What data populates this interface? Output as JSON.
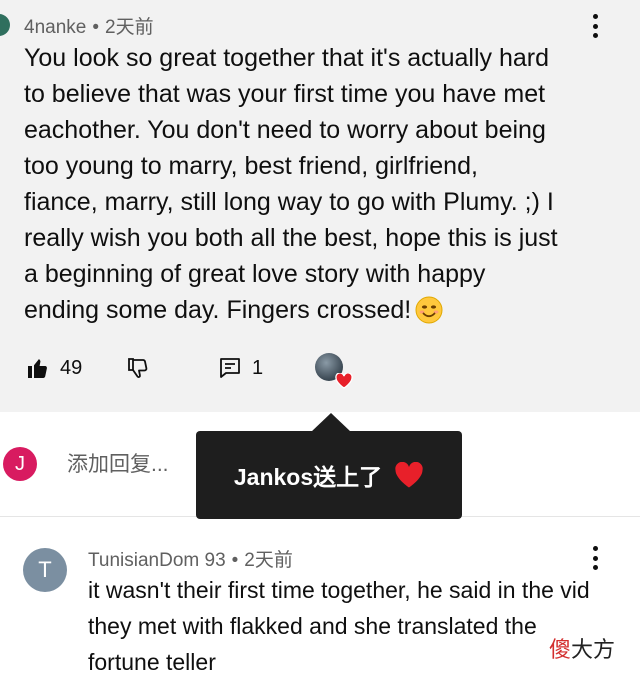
{
  "comment1": {
    "author": "4nanke",
    "separator": "•",
    "time": "2天前",
    "text": "You look so great together that it's actually hard\nto believe that was your first time you have met\neachother. You don't need to worry about being\ntoo young to marry, best friend, girlfriend,\nfiance, marry, still long way to go with Plumy. ;) I\nreally wish you both all the best, hope this is just\na beginning of great love story with happy\nending some day. Fingers crossed!",
    "emoji": "smiling-face-emoji",
    "likes": "49",
    "replies": "1",
    "icons": {
      "like": "thumbs-up-filled-icon",
      "dislike": "thumbs-down-icon",
      "reply": "comment-icon",
      "creator_heart": "heart-icon",
      "menu": "more-vert-icon"
    }
  },
  "reply_box": {
    "avatar_letter": "J",
    "avatar_color": "#d81b60",
    "placeholder": "添加回复..."
  },
  "tooltip": {
    "text": "Jankos送上了"
  },
  "comment2": {
    "avatar_letter": "T",
    "avatar_color": "#7b8fa1",
    "author": "TunisianDom 93",
    "separator": "•",
    "time": "2天前",
    "text": "it wasn't their first time together, he said in the vid they met with flakked and she translated the fortune teller"
  },
  "watermark": {
    "part1": "傻",
    "part2": "大方"
  },
  "colors": {
    "heart": "#e8202a",
    "comment_bg": "#f2f2f2",
    "tooltip_bg": "#1e1e1e"
  }
}
